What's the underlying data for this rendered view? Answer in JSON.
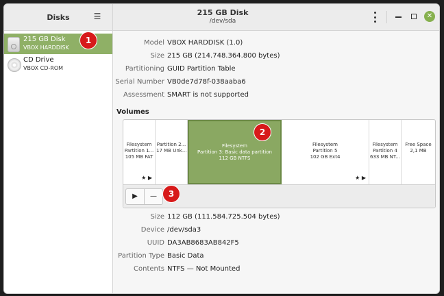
{
  "sidebar": {
    "title": "Disks",
    "disks": [
      {
        "name": "215 GB Disk",
        "sub": "VBOX HARDDISK"
      },
      {
        "name": "CD Drive",
        "sub": "VBOX CD-ROM"
      }
    ]
  },
  "header": {
    "title": "215 GB Disk",
    "subtitle": "/dev/sda"
  },
  "disk_props": [
    {
      "label": "Model",
      "value": "VBOX HARDDISK (1.0)"
    },
    {
      "label": "Size",
      "value": "215 GB (214.748.364.800 bytes)"
    },
    {
      "label": "Partitioning",
      "value": "GUID Partition Table"
    },
    {
      "label": "Serial Number",
      "value": "VB0de7d78f-038aaba6"
    },
    {
      "label": "Assessment",
      "value": "SMART is not supported"
    }
  ],
  "volumes": {
    "title": "Volumes",
    "partitions": [
      {
        "l1": "Filesystem",
        "l2": "Partition 1...",
        "l3": "105 MB FAT",
        "flags": "★ ▶"
      },
      {
        "l1": "Partition 2...",
        "l2": "17 MB Unk...",
        "l3": "",
        "flags": ""
      },
      {
        "l1": "Filesystem",
        "l2": "Partition 3: Basic data partition",
        "l3": "112 GB NTFS",
        "flags": ""
      },
      {
        "l1": "Filesystem",
        "l2": "Partition 5",
        "l3": "102 GB Ext4",
        "flags": "★ ▶"
      },
      {
        "l1": "Filesystem",
        "l2": "Partition 4",
        "l3": "633 MB NT...",
        "flags": ""
      },
      {
        "l1": "Free Space",
        "l2": "2,1 MB",
        "l3": "",
        "flags": ""
      }
    ]
  },
  "toolbar": {
    "play": "▶",
    "minus": "—"
  },
  "partition_props": [
    {
      "label": "Size",
      "value": "112 GB (111.584.725.504 bytes)"
    },
    {
      "label": "Device",
      "value": "/dev/sda3"
    },
    {
      "label": "UUID",
      "value": "DA3AB8683AB842F5"
    },
    {
      "label": "Partition Type",
      "value": "Basic Data"
    },
    {
      "label": "Contents",
      "value": "NTFS — Not Mounted"
    }
  ],
  "annotations": [
    "1",
    "2",
    "3"
  ],
  "colors": {
    "selection": "#8fb066",
    "badge": "#d71a1a"
  }
}
